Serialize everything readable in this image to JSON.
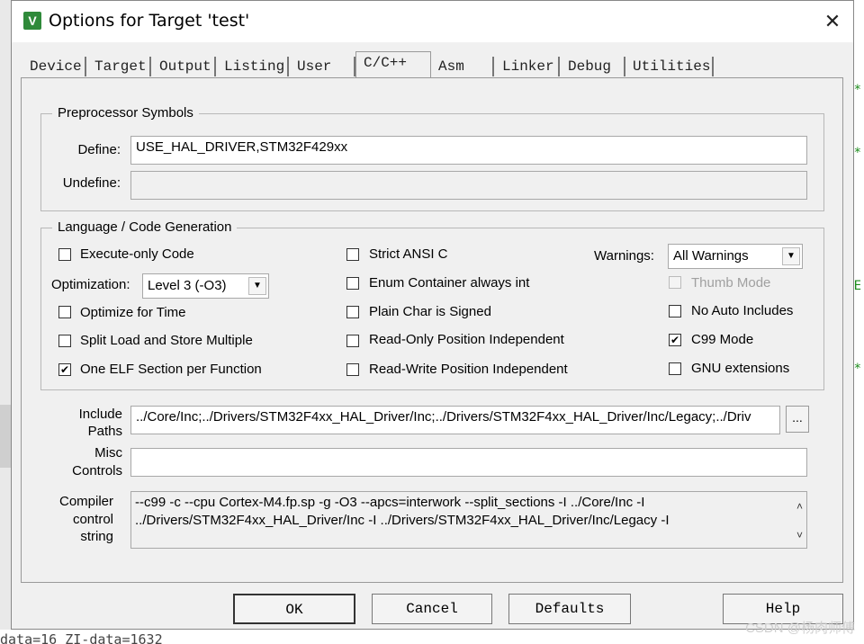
{
  "window": {
    "title": "Options for Target 'test'",
    "app_icon": "keil-uvision-icon",
    "close_glyph": "✕"
  },
  "tabs": [
    {
      "label": "Device"
    },
    {
      "label": "Target"
    },
    {
      "label": "Output"
    },
    {
      "label": "Listing"
    },
    {
      "label": "User"
    },
    {
      "label": "C/C++"
    },
    {
      "label": "Asm"
    },
    {
      "label": "Linker"
    },
    {
      "label": "Debug"
    },
    {
      "label": "Utilities"
    }
  ],
  "active_tab": "C/C++",
  "preprocessor": {
    "title": "Preprocessor Symbols",
    "define_label": "Define:",
    "define_value": "USE_HAL_DRIVER,STM32F429xx",
    "undefine_label": "Undefine:",
    "undefine_value": ""
  },
  "language": {
    "title": "Language / Code Generation",
    "execute_only": {
      "label": "Execute-only Code",
      "checked": false
    },
    "optimization_label": "Optimization:",
    "optimization_value": "Level 3 (-O3)",
    "optimize_time": {
      "label": "Optimize for Time",
      "checked": false
    },
    "split_load": {
      "label": "Split Load and Store Multiple",
      "checked": false
    },
    "one_elf": {
      "label": "One ELF Section per Function",
      "checked": true
    },
    "strict_ansi": {
      "label": "Strict ANSI C",
      "checked": false
    },
    "enum_container": {
      "label": "Enum Container always int",
      "checked": false
    },
    "plain_char": {
      "label": "Plain Char is Signed",
      "checked": false
    },
    "ro_pi": {
      "label": "Read-Only Position Independent",
      "checked": false
    },
    "rw_pi": {
      "label": "Read-Write Position Independent",
      "checked": false
    },
    "warnings_label": "Warnings:",
    "warnings_value": "All Warnings",
    "thumb_mode": {
      "label": "Thumb Mode",
      "checked": false,
      "disabled": true
    },
    "no_auto_includes": {
      "label": "No Auto Includes",
      "checked": false
    },
    "c99_mode": {
      "label": "C99 Mode",
      "checked": true
    },
    "gnu_ext": {
      "label": "GNU extensions",
      "checked": false
    }
  },
  "include": {
    "label_1": "Include",
    "label_2": "Paths",
    "value": "../Core/Inc;../Drivers/STM32F4xx_HAL_Driver/Inc;../Drivers/STM32F4xx_HAL_Driver/Inc/Legacy;../Driv",
    "browse_label": "..."
  },
  "misc": {
    "label_1": "Misc",
    "label_2": "Controls",
    "value": ""
  },
  "compiler": {
    "label_1": "Compiler",
    "label_2": "control",
    "label_3": "string",
    "line_1": "--c99 -c --cpu Cortex-M4.fp.sp -g -O3 --apcs=interwork --split_sections -I ../Core/Inc -I",
    "line_2": "../Drivers/STM32F4xx_HAL_Driver/Inc -I ../Drivers/STM32F4xx_HAL_Driver/Inc/Legacy -I"
  },
  "buttons": {
    "ok": "OK",
    "cancel": "Cancel",
    "defaults": "Defaults",
    "help": "Help"
  },
  "background": {
    "status_text": "data=16 ZI-data=1632",
    "watermark": "CSDN @杨肉师傅"
  }
}
